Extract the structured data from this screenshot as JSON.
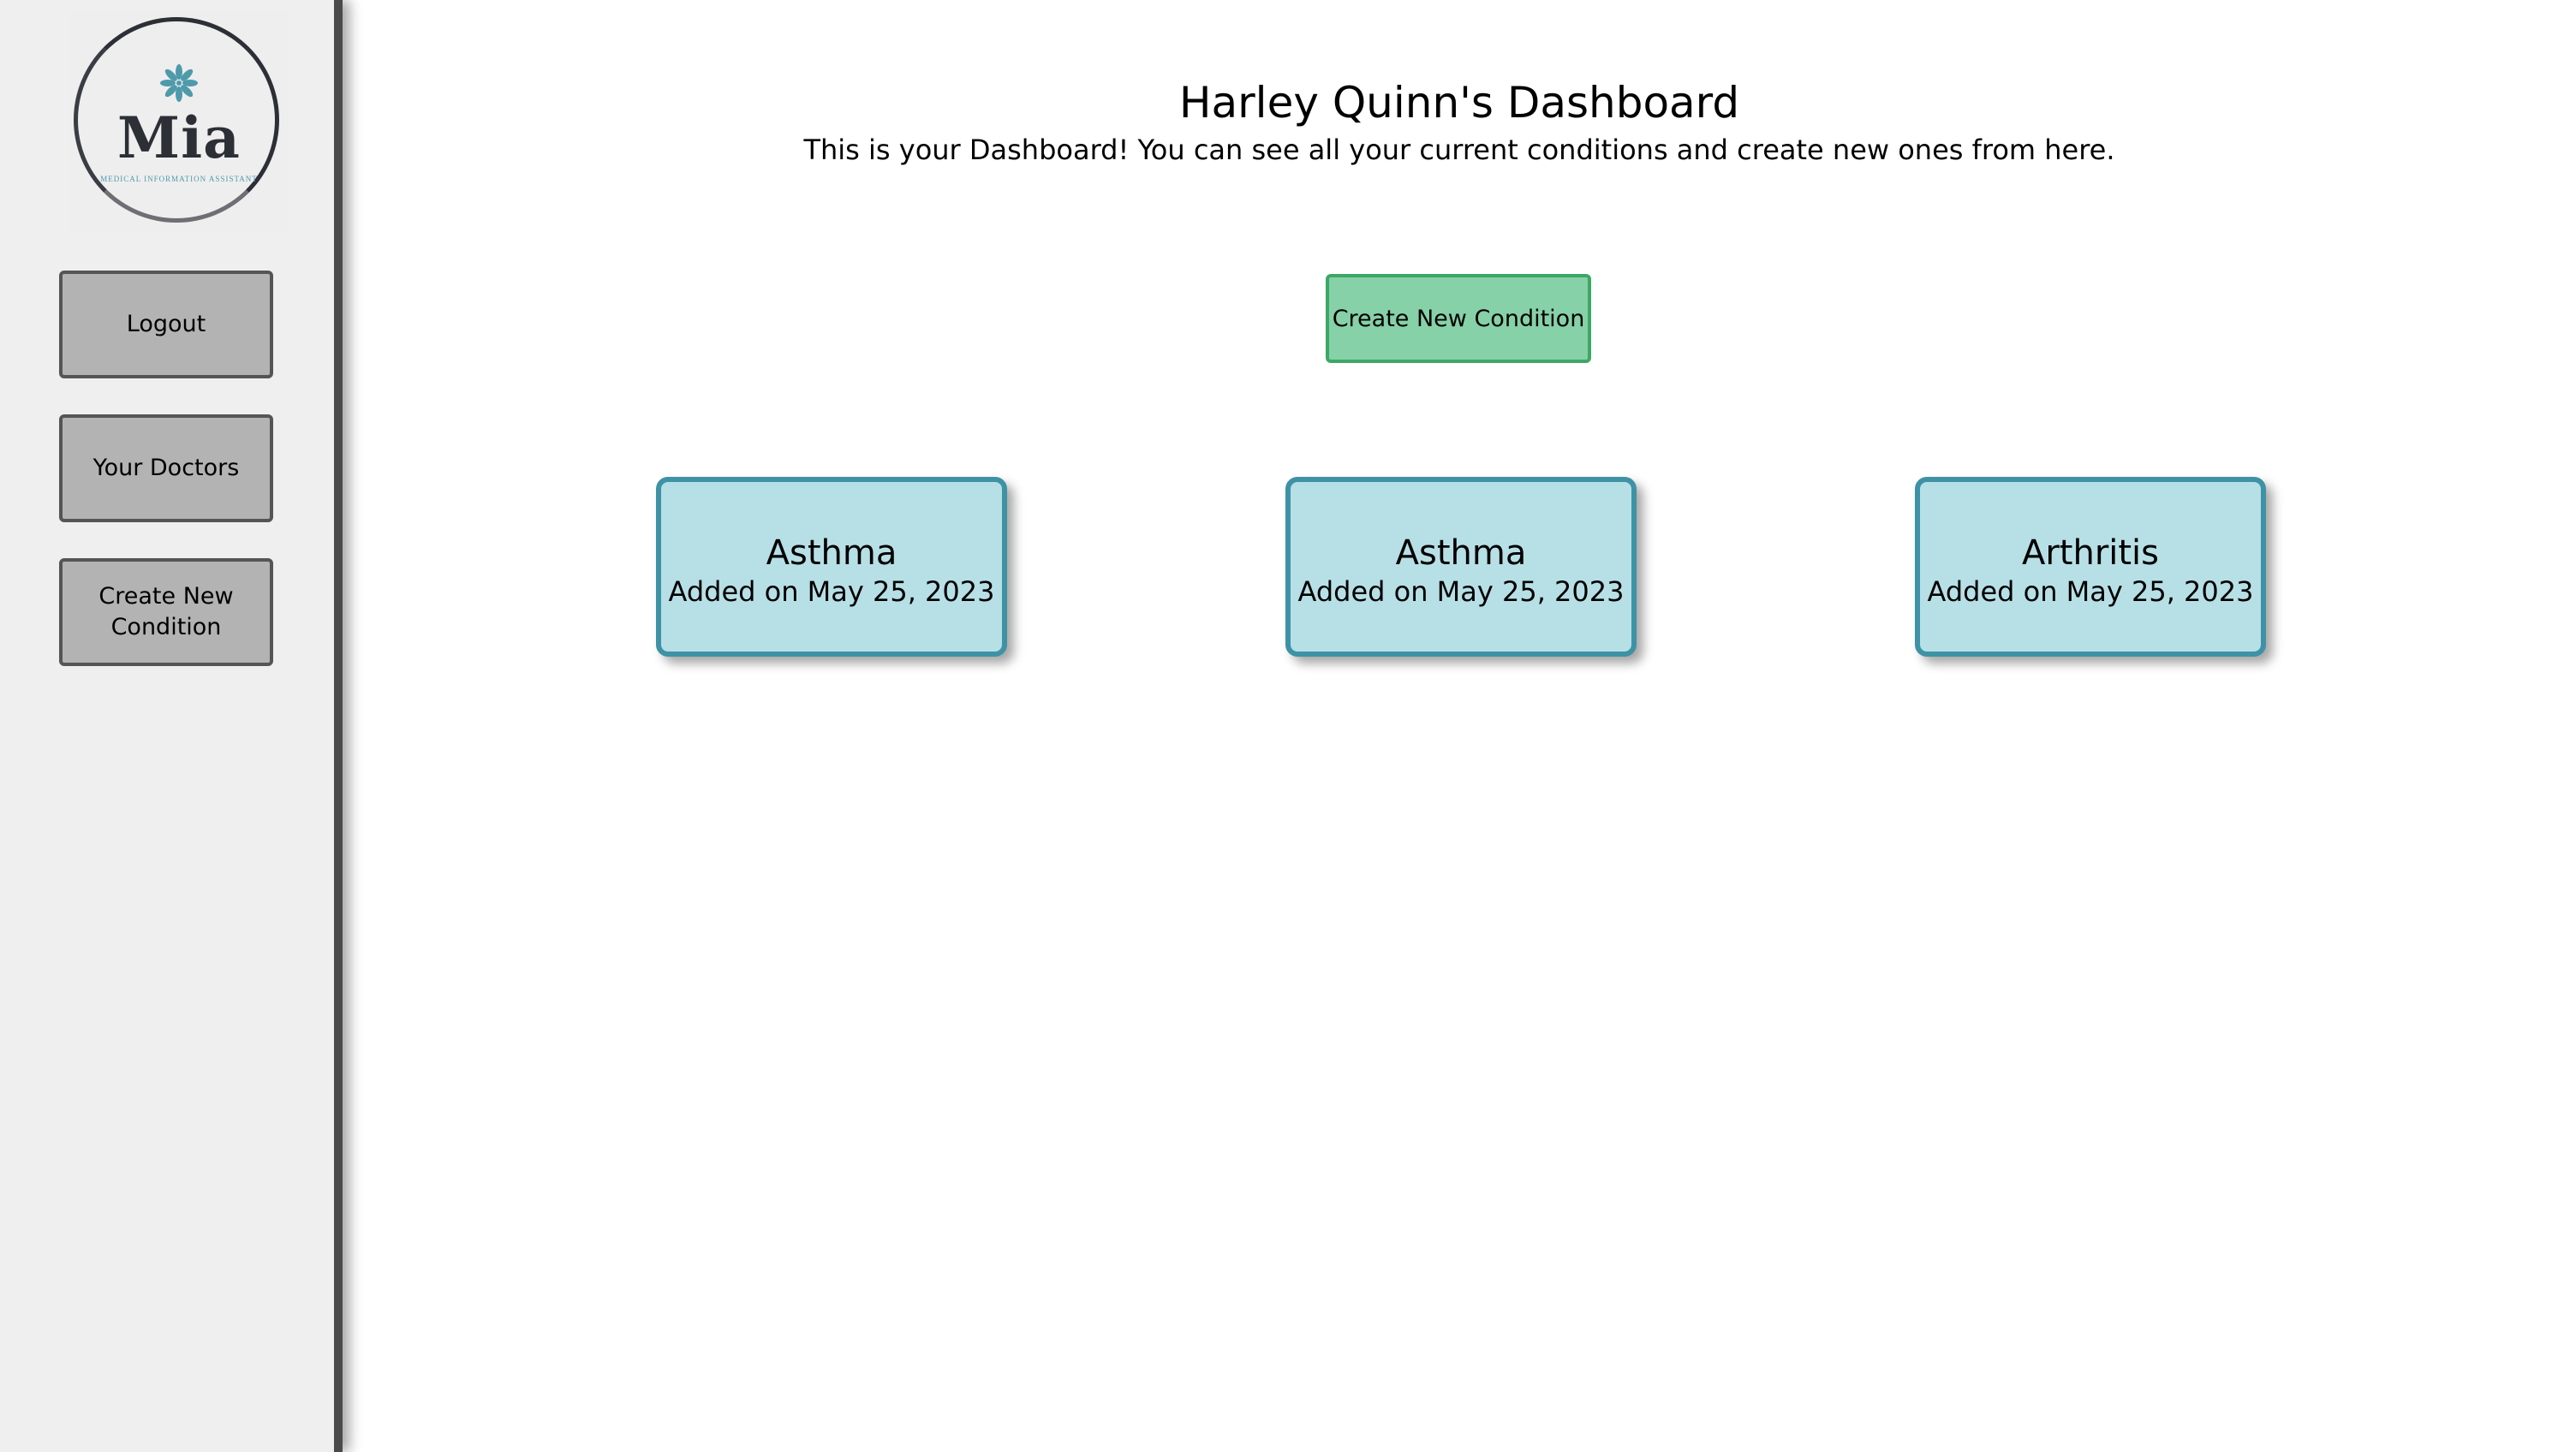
{
  "sidebar": {
    "logo": {
      "name": "Mia",
      "tagline": "MEDICAL INFORMATION ASSISTANT",
      "ring_color": "#2c2f35",
      "flower_color": "#4f9aaa"
    },
    "buttons": [
      {
        "label": "Logout"
      },
      {
        "label": "Your Doctors"
      },
      {
        "label": "Create New Condition"
      }
    ]
  },
  "main": {
    "title": "Harley Quinn's Dashboard",
    "subtitle": "This is your Dashboard! You can see all your current conditions and create new ones from here.",
    "create_button_label": "Create New Condition",
    "conditions": [
      {
        "name": "Asthma",
        "added": "Added on May 25, 2023"
      },
      {
        "name": "Asthma",
        "added": "Added on May 25, 2023"
      },
      {
        "name": "Arthritis",
        "added": "Added on May 25, 2023"
      }
    ]
  },
  "colors": {
    "sidebar_bg": "#efefef",
    "sidebar_button": "#b3b3b3",
    "create_button": "#86d1a8",
    "card_bg": "#b7dfe6",
    "card_border": "#3e92a5"
  }
}
